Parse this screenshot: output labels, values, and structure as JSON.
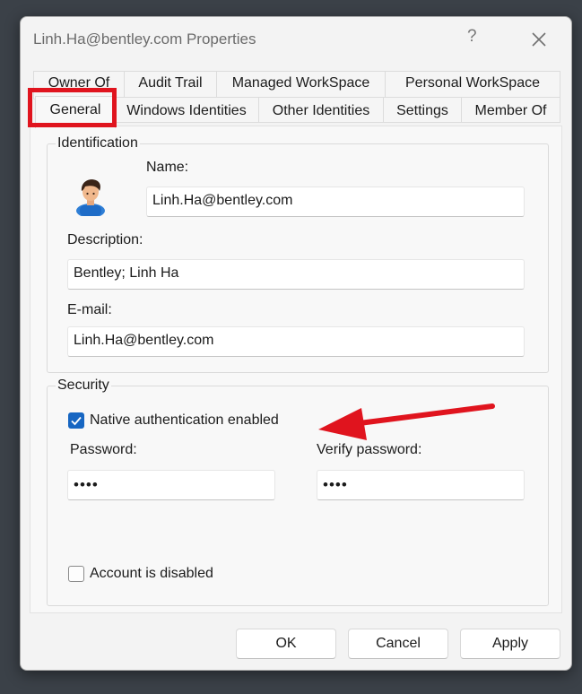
{
  "window": {
    "title": "Linh.Ha@bentley.com Properties",
    "help_glyph": "?",
    "close_glyph": "✕"
  },
  "tabs": {
    "row1": [
      "Owner Of",
      "Audit Trail",
      "Managed WorkSpace",
      "Personal WorkSpace"
    ],
    "row2": [
      "General",
      "Windows Identities",
      "Other Identities",
      "Settings",
      "Member Of"
    ],
    "active": "General"
  },
  "identification": {
    "group_title": "Identification",
    "avatar_icon": "user-avatar-icon",
    "name_label": "Name:",
    "name_value": "Linh.Ha@bentley.com",
    "description_label": "Description:",
    "description_value": "Bentley; Linh Ha",
    "email_label": "E-mail:",
    "email_value": "Linh.Ha@bentley.com"
  },
  "security": {
    "group_title": "Security",
    "native_auth_label": "Native authentication enabled",
    "native_auth_checked": true,
    "password_label": "Password:",
    "password_value": "••••",
    "verify_password_label": "Verify password:",
    "verify_password_value": "••••",
    "account_disabled_label": "Account is disabled",
    "account_disabled_checked": false
  },
  "buttons": {
    "ok": "OK",
    "cancel": "Cancel",
    "apply": "Apply"
  },
  "colors": {
    "accent": "#1766c2",
    "annotation": "#e0141e"
  }
}
